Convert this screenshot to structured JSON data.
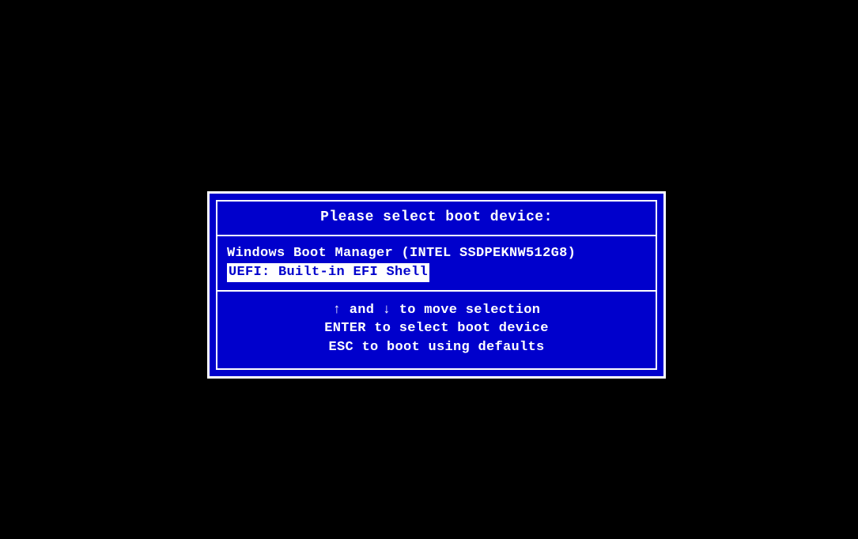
{
  "dialog": {
    "title": "Please select boot device:",
    "options": [
      {
        "label": "Windows Boot Manager (INTEL SSDPEKNW512G8)",
        "selected": false
      },
      {
        "label": "UEFI: Built-in EFI Shell",
        "selected": true
      }
    ],
    "help": {
      "up_arrow": "↑",
      "down_arrow": "↓",
      "line1_prefix": " and ",
      "line1_suffix": " to move selection",
      "line2": "ENTER to select boot device",
      "line3": "ESC to boot using defaults"
    }
  }
}
